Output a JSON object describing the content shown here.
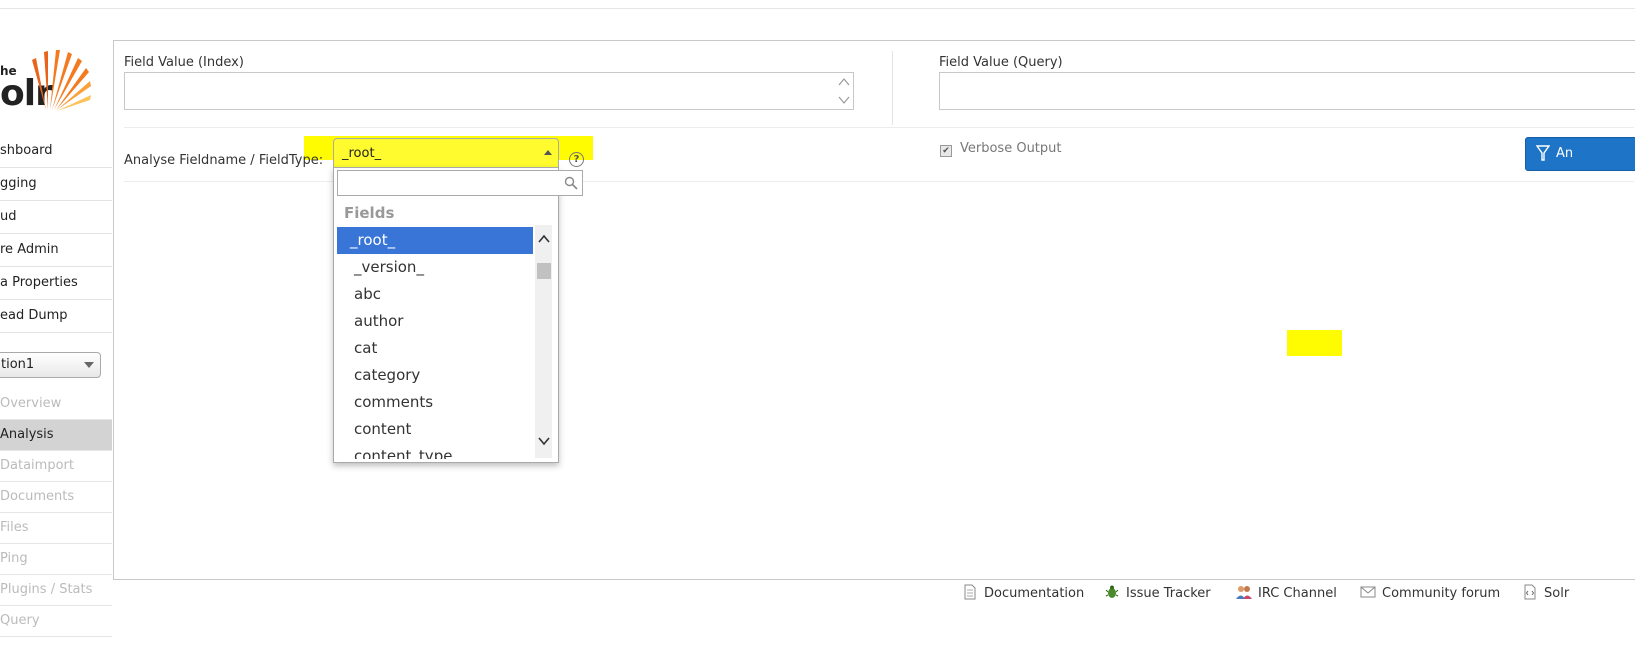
{
  "logo": {
    "line1": "he",
    "line2": "olr"
  },
  "sidebar": {
    "items": [
      {
        "label": "shboard"
      },
      {
        "label": "gging"
      },
      {
        "label": "ud"
      },
      {
        "label": "re Admin"
      },
      {
        "label": "a Properties"
      },
      {
        "label": "ead Dump"
      }
    ],
    "core_selector": "tion1",
    "core_items": [
      {
        "label": "Overview",
        "active": false
      },
      {
        "label": "Analysis",
        "active": true
      },
      {
        "label": "Dataimport",
        "active": false
      },
      {
        "label": "Documents",
        "active": false
      },
      {
        "label": "Files",
        "active": false
      },
      {
        "label": "Ping",
        "active": false
      },
      {
        "label": "Plugins / Stats",
        "active": false
      },
      {
        "label": "Query",
        "active": false
      }
    ]
  },
  "main": {
    "field_value_index_label": "Field Value (Index)",
    "field_value_query_label": "Field Value (Query)",
    "fieldname_label": "Analyse Fieldname / FieldType:",
    "fieldname_selected": "_root_",
    "help_glyph": "?",
    "verbose_label": "Verbose Output",
    "analyse_button_label": "An",
    "dropdown": {
      "search_value": "",
      "group_label": "Fields",
      "options": [
        "_root_",
        "_version_",
        "abc",
        "author",
        "cat",
        "category",
        "comments",
        "content",
        "content_type"
      ],
      "selected_index": 0
    }
  },
  "footer": {
    "documentation": "Documentation",
    "issue_tracker": "Issue Tracker",
    "irc_channel": "IRC Channel",
    "community_forum": "Community forum",
    "solr_query_syntax": "Solr"
  },
  "colors": {
    "highlight": "#fffb00",
    "selected_option": "#3875d7",
    "button": "#1e74c6",
    "sidebar_active": "#d3d3d3"
  }
}
